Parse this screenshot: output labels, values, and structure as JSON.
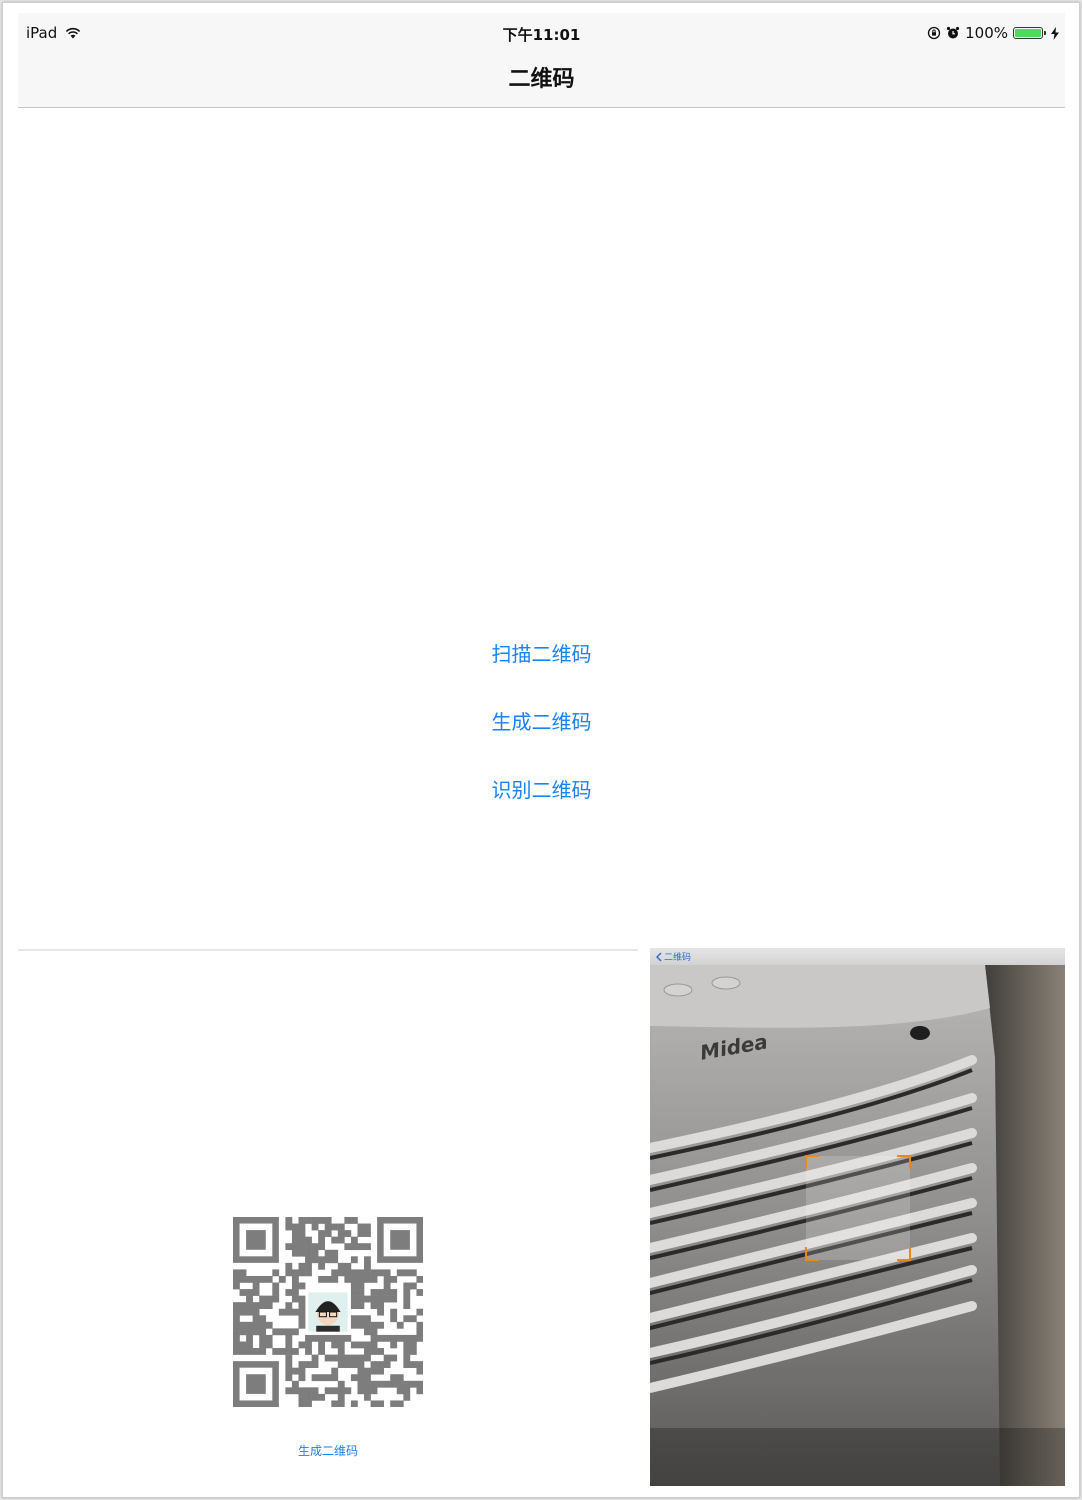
{
  "status_bar": {
    "device": "iPad",
    "time": "下午11:01",
    "battery_percent": "100%",
    "battery_level": 1.0,
    "icons": [
      "wifi-icon",
      "rotation-lock-icon",
      "alarm-icon",
      "battery-icon",
      "charging-bolt-icon"
    ]
  },
  "nav": {
    "title": "二维码"
  },
  "menu": {
    "items": [
      {
        "label": "扫描二维码"
      },
      {
        "label": "生成二维码"
      },
      {
        "label": "识别二维码"
      }
    ]
  },
  "qr_screen": {
    "caption": "生成二维码"
  },
  "scan_screen": {
    "back_label": "二维码",
    "camera_logo_text": "Midea"
  },
  "colors": {
    "accent": "#1a82f7",
    "scan_corner": "#e68a1c",
    "battery": "#4cd964"
  }
}
